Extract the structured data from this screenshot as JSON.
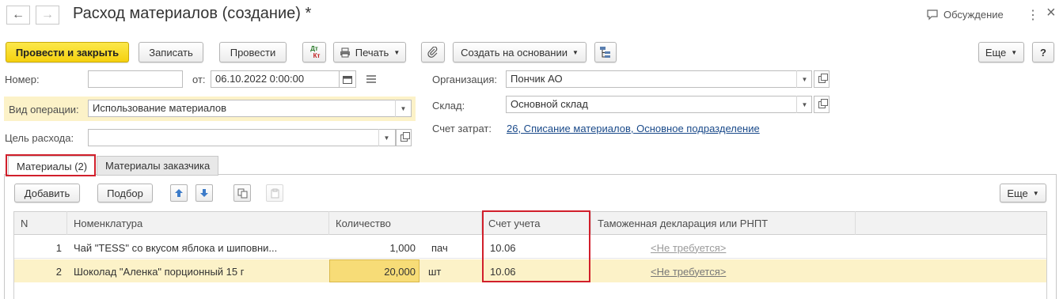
{
  "header": {
    "title": "Расход материалов (создание) *",
    "discussion_label": "Обсуждение",
    "more_icon": "⋮",
    "close_icon": "×"
  },
  "toolbar": {
    "post_close_label": "Провести и закрыть",
    "save_label": "Записать",
    "post_label": "Провести",
    "dtkt_label_top": "Дт",
    "dtkt_label_bottom": "Кт",
    "print_label": "Печать",
    "create_based_label": "Создать на основании",
    "more_label": "Еще",
    "help_label": "?"
  },
  "form": {
    "number_label": "Номер:",
    "number_value": "",
    "from_label": "от:",
    "date_value": "06.10.2022  0:00:00",
    "org_label": "Организация:",
    "org_value": "Пончик АО",
    "op_type_label": "Вид операции:",
    "op_type_value": "Использование материалов",
    "warehouse_label": "Склад:",
    "warehouse_value": "Основной склад",
    "cost_account_label": "Счет затрат:",
    "cost_account_value": "26, Списание материалов, Основное подразделение",
    "purpose_label": "Цель расхода:",
    "purpose_value": ""
  },
  "tabs": [
    {
      "label": "Материалы (2)",
      "active": true
    },
    {
      "label": "Материалы заказчика",
      "active": false
    }
  ],
  "table_toolbar": {
    "add_label": "Добавить",
    "pick_label": "Подбор",
    "more_label": "Еще"
  },
  "table": {
    "columns": [
      "N",
      "Номенклатура",
      "Количество",
      "Счет учета",
      "Таможенная декларация или РНПТ"
    ],
    "rows": [
      {
        "n": "1",
        "item": "Чай \"TESS\" со вкусом яблока и шиповни...",
        "qty": "1,000",
        "unit": "пач",
        "account": "10.06",
        "customs": "<Не требуется>"
      },
      {
        "n": "2",
        "item": "Шоколад \"Аленка\" порционный 15 г",
        "qty": "20,000",
        "unit": "шт",
        "account": "10.06",
        "customs": "<Не требуется>"
      }
    ]
  },
  "colors": {
    "primary_button": "#f5d10f",
    "highlight_row": "#fcf2c8",
    "selected_cell": "#f7dc77",
    "annotation_red": "#d11f2b",
    "link": "#1a4a8a"
  }
}
